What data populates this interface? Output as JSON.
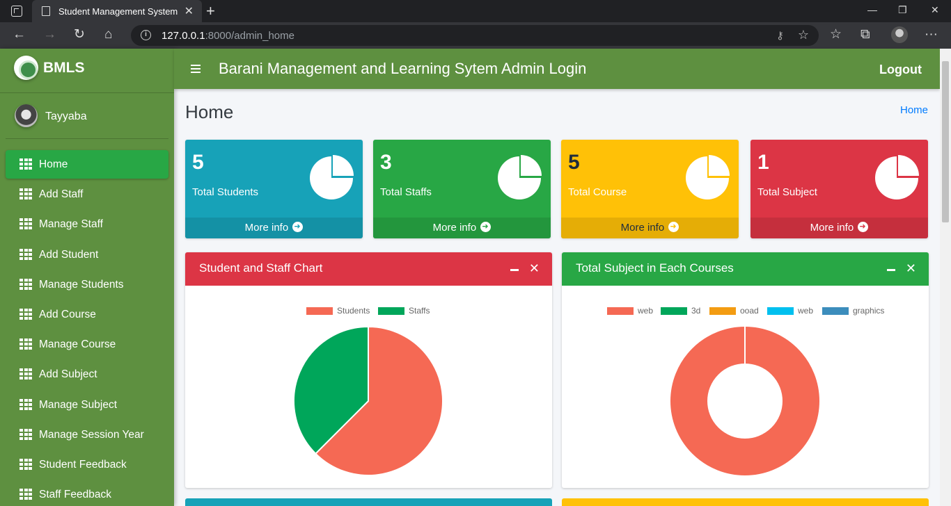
{
  "browser": {
    "tab_title": "Student Management System",
    "url_host": "127.0.0.1",
    "url_path": ":8000/admin_home"
  },
  "app": {
    "brand": "BMLS",
    "user_name": "Tayyaba",
    "header_title": "Barani Management and Learning Sytem Admin Login",
    "logout_label": "Logout",
    "page_title": "Home",
    "breadcrumb": "Home"
  },
  "sidebar": {
    "items": [
      {
        "label": "Home"
      },
      {
        "label": "Add Staff"
      },
      {
        "label": "Manage Staff"
      },
      {
        "label": "Add Student"
      },
      {
        "label": "Manage Students"
      },
      {
        "label": "Add Course"
      },
      {
        "label": "Manage Course"
      },
      {
        "label": "Add Subject"
      },
      {
        "label": "Manage Subject"
      },
      {
        "label": "Manage Session Year"
      },
      {
        "label": "Student Feedback"
      },
      {
        "label": "Staff Feedback"
      }
    ]
  },
  "stats": [
    {
      "count": "5",
      "label": "Total Students",
      "more": "More info"
    },
    {
      "count": "3",
      "label": "Total Staffs",
      "more": "More info"
    },
    {
      "count": "5",
      "label": "Total Course",
      "more": "More info"
    },
    {
      "count": "1",
      "label": "Total Subject",
      "more": "More info"
    }
  ],
  "colors": {
    "sidebar": "#5e9040",
    "active": "#28a745",
    "info": "#17a2b8",
    "success": "#28a745",
    "warning": "#ffc107",
    "danger": "#dc3545"
  },
  "cards": {
    "left_title": "Student and Staff Chart",
    "right_title": "Total Subject in Each Courses"
  },
  "chart_data": [
    {
      "type": "pie",
      "title": "Student and Staff Chart",
      "categories": [
        "Students",
        "Staffs"
      ],
      "values": [
        5,
        3
      ],
      "colors": [
        "#f56954",
        "#00a65a"
      ],
      "legend": "top"
    },
    {
      "type": "doughnut",
      "title": "Total Subject in Each Courses",
      "categories": [
        "web",
        "3d",
        "ooad",
        "web",
        "graphics"
      ],
      "values": [
        1,
        0,
        0,
        0,
        0
      ],
      "colors": [
        "#f56954",
        "#00a65a",
        "#f39c12",
        "#00c0ef",
        "#3c8dbc"
      ],
      "legend": "top"
    }
  ]
}
